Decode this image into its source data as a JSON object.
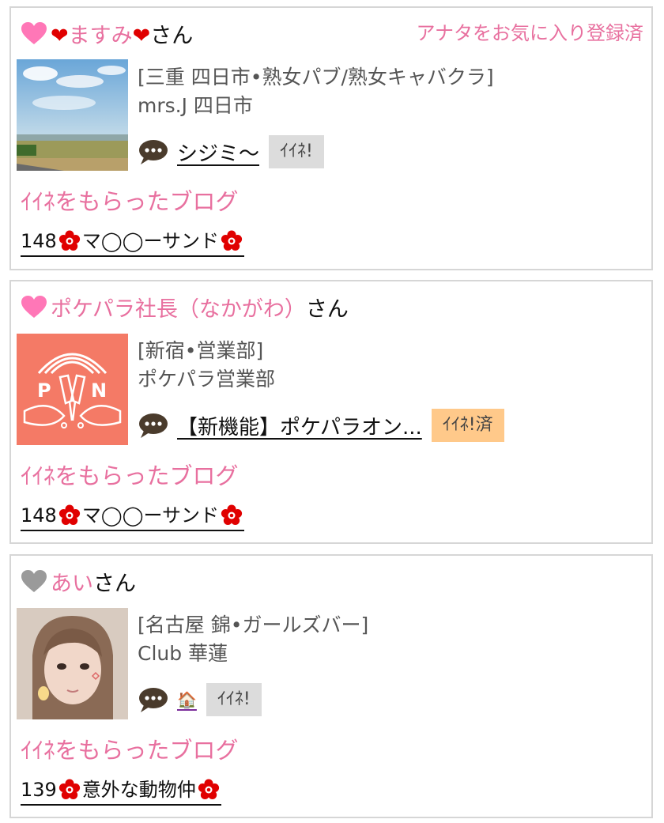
{
  "cards": [
    {
      "name": "❤ますみ❤",
      "suffix": "さん",
      "fav_status": "アナタをお気に入り登録済",
      "shop_category": "[三重 四日市•熟女パブ/熟女キャバクラ]",
      "shop_name": "mrs.J 四日市",
      "blog_title": "シジミ～",
      "iine_label": "ｲｲﾈ!",
      "section_title": "ｲｲﾈをもらったブログ",
      "liked_blog_number": "148",
      "liked_blog_title": "マ◯◯ーサンド",
      "heart_color": "#ff77b7"
    },
    {
      "name": "ポケパラ社長（なかがわ）",
      "suffix": "さん",
      "shop_category": "[新宿•営業部]",
      "shop_name": "ポケパラ営業部",
      "blog_title": "【新機能】ポケパラオン...",
      "iine_label": "ｲｲﾈ!済",
      "section_title": "ｲｲﾈをもらったブログ",
      "liked_blog_number": "148",
      "liked_blog_title": "マ◯◯ーサンド",
      "heart_color": "#ff77b7"
    },
    {
      "name": "あい",
      "suffix": "さん",
      "shop_category": "[名古屋 錦•ガールズバー]",
      "shop_name": "Club 華蓮",
      "blog_title": "🏠",
      "iine_label": "ｲｲﾈ!",
      "section_title": "ｲｲﾈをもらったブログ",
      "liked_blog_number": "139",
      "liked_blog_title": "意外な動物仲",
      "heart_color": "#9a9a9a"
    }
  ],
  "logo_text": "PON",
  "icons": {
    "heart": "heart-icon",
    "bubble": "speech-bubble-icon",
    "flower": "flower-icon"
  },
  "colors": {
    "pink": "#e8709f",
    "red": "#e00000",
    "done_badge": "#ffc98a",
    "badge": "#dcdcdc",
    "logo_bg": "#f47a66"
  }
}
